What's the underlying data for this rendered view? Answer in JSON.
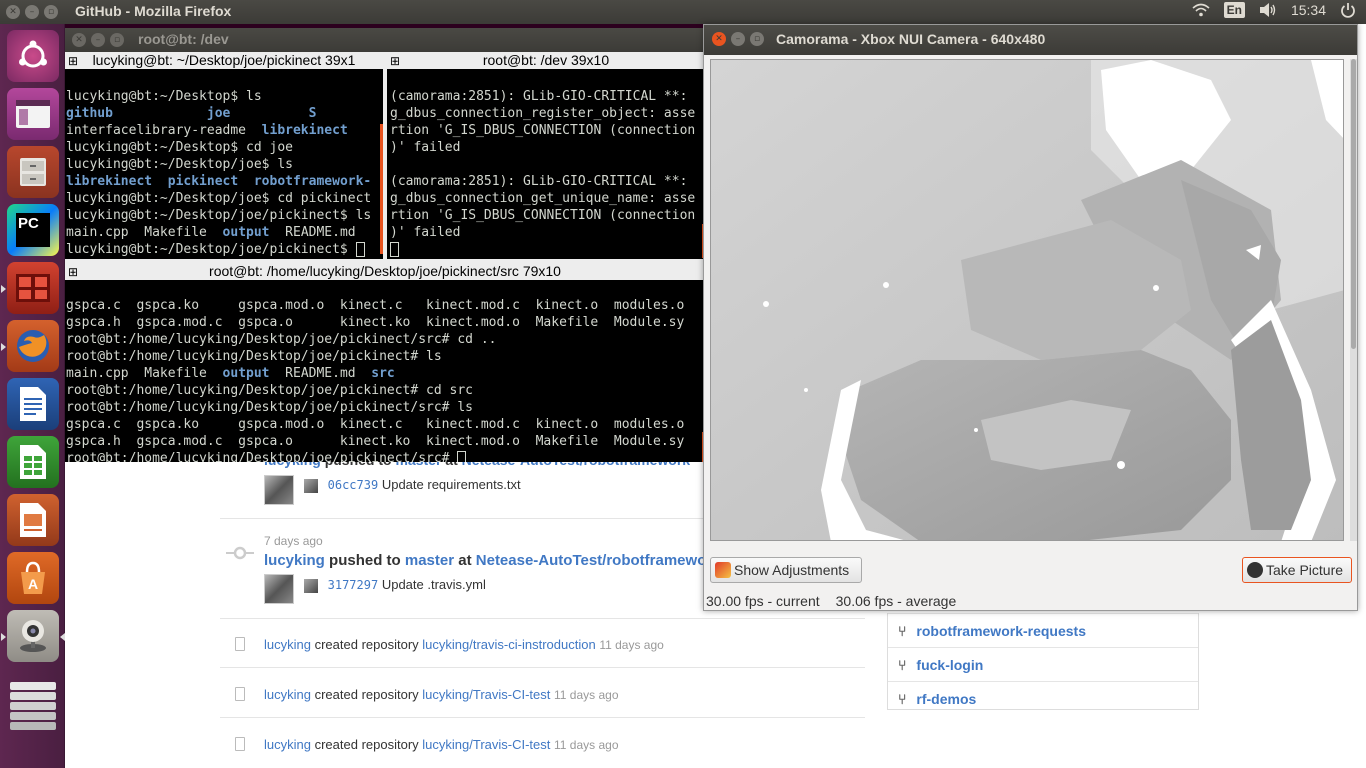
{
  "top_panel": {
    "title": "GitHub - Mozilla Firefox",
    "lang": "En",
    "clock": "15:34",
    "icons": [
      "wifi-icon",
      "volume-icon",
      "power-icon"
    ]
  },
  "launcher": {
    "items": [
      "ubuntu-dash",
      "window-app",
      "file-cabinet",
      "pycharm",
      "red-app",
      "firefox",
      "libreoffice-writer",
      "libreoffice-calc",
      "libreoffice-impress",
      "software-center",
      "webcam",
      "workspace-switcher"
    ],
    "pycharm_label": "PC"
  },
  "terminal": {
    "window_title": "root@bt: /dev",
    "pane1": {
      "title": "lucyking@bt: ~/Desktop/joe/pickinect 39x1",
      "lines": [
        "lucyking@bt:~/Desktop$ ls",
        "",
        "",
        "lucyking@bt:~/Desktop$ cd joe",
        "lucyking@bt:~/Desktop/joe$ ls",
        "",
        "lucyking@bt:~/Desktop/joe$ cd pickinect",
        "lucyking@bt:~/Desktop/joe/pickinect$ ls",
        "",
        "lucyking@bt:~/Desktop/joe/pickinect$ "
      ],
      "dir_line1": [
        "github",
        "joe",
        "S"
      ],
      "dir_line2_plain": "interfacelibrary-readme",
      "dir_line2_dir": "librekinect",
      "dir_line5": [
        "librekinect",
        "pickinect",
        "robotframework-"
      ],
      "ls_line_plain1": "main.cpp  Makefile  ",
      "ls_line_dir": "output",
      "ls_line_plain2": "  README.md"
    },
    "pane2": {
      "title": "root@bt: /dev 39x10",
      "lines": [
        "(camorama:2851): GLib-GIO-CRITICAL **:",
        "g_dbus_connection_register_object: asse",
        "rtion 'G_IS_DBUS_CONNECTION (connection",
        ")' failed",
        "",
        "(camorama:2851): GLib-GIO-CRITICAL **:",
        "g_dbus_connection_get_unique_name: asse",
        "rtion 'G_IS_DBUS_CONNECTION (connection",
        ")' failed",
        ""
      ]
    },
    "pane3": {
      "title": "root@bt: /home/lucyking/Desktop/joe/pickinect/src 79x10",
      "lines": [
        "gspca.c  gspca.ko     gspca.mod.o  kinect.c   kinect.mod.c  kinect.o  modules.o",
        "gspca.h  gspca.mod.c  gspca.o      kinect.ko  kinect.mod.o  Makefile  Module.sy",
        "root@bt:/home/lucyking/Desktop/joe/pickinect/src# cd ..",
        "root@bt:/home/lucyking/Desktop/joe/pickinect# ls",
        "",
        "root@bt:/home/lucyking/Desktop/joe/pickinect# cd src",
        "root@bt:/home/lucyking/Desktop/joe/pickinect/src# ls",
        "gspca.c  gspca.ko     gspca.mod.o  kinect.c   kinect.mod.c  kinect.o  modules.o",
        "gspca.h  gspca.mod.c  gspca.o      kinect.ko  kinect.mod.o  Makefile  Module.sy",
        "root@bt:/home/lucyking/Desktop/joe/pickinect/src# "
      ],
      "ls_plain1": "main.cpp  Makefile  ",
      "ls_dir1": "output",
      "ls_plain2": "  README.md  ",
      "ls_dir2": "src"
    }
  },
  "camorama": {
    "title": "Camorama - Xbox NUI Camera - 640x480",
    "show_adjustments": "Show Adjustments",
    "take_picture": "Take Picture",
    "fps_current": "30.00 fps - current",
    "fps_average": "30.06 fps - average"
  },
  "github": {
    "feed": [
      {
        "user": "lucyking",
        "action": "pushed to",
        "branch": "master",
        "at": "at",
        "repo": "Netease-AutoTest/robotframework",
        "sha": "06cc739",
        "message": "Update requirements.txt"
      },
      {
        "time": "7 days ago",
        "user": "lucyking",
        "action": "pushed to",
        "branch": "master",
        "at": "at",
        "repo": "Netease-AutoTest/robotframework",
        "sha": "3177297",
        "message": "Update .travis.yml"
      }
    ],
    "created": [
      {
        "user": "lucyking",
        "action": "created repository",
        "repo": "lucyking/travis-ci-instroduction",
        "time": "11 days ago"
      },
      {
        "user": "lucyking",
        "action": "created repository",
        "repo": "lucyking/Travis-CI-test",
        "time": "11 days ago"
      },
      {
        "user": "lucyking",
        "action": "created repository",
        "repo": "lucyking/Travis-CI-test",
        "time": "11 days ago"
      }
    ],
    "sidebar_repos": [
      "robotframework-requests",
      "fuck-login",
      "rf-demos"
    ]
  }
}
